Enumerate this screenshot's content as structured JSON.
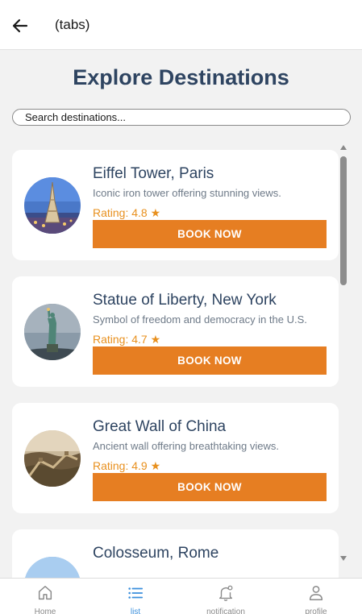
{
  "header": {
    "title": "(tabs)"
  },
  "page": {
    "title": "Explore Destinations"
  },
  "search": {
    "placeholder": "Search destinations..."
  },
  "destinations": [
    {
      "name": "Eiffel Tower, Paris",
      "description": "Iconic iron tower offering stunning views.",
      "rating": "Rating: 4.8 ★",
      "button": "BOOK NOW"
    },
    {
      "name": "Statue of Liberty, New York",
      "description": "Symbol of freedom and democracy in the U.S.",
      "rating": "Rating: 4.7 ★",
      "button": "BOOK NOW"
    },
    {
      "name": "Great Wall of China",
      "description": "Ancient wall offering breathtaking views.",
      "rating": "Rating: 4.9 ★",
      "button": "BOOK NOW"
    },
    {
      "name": "Colosseum, Rome"
    }
  ],
  "tabs": [
    {
      "label": "Home",
      "icon": "home-icon"
    },
    {
      "label": "list",
      "icon": "list-icon",
      "active": true
    },
    {
      "label": "notification",
      "icon": "bell-icon"
    },
    {
      "label": "profile",
      "icon": "user-icon"
    }
  ],
  "colors": {
    "accent": "#e67e22",
    "title": "#2e4461",
    "rating": "#e8901e",
    "active_tab": "#3a8fdc"
  }
}
